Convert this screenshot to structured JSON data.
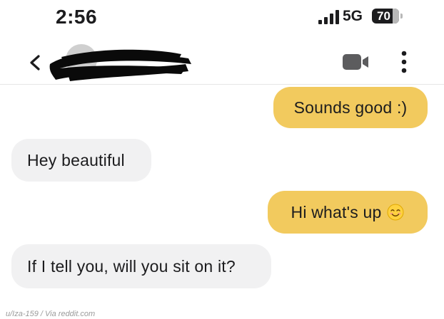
{
  "status_bar": {
    "time": "2:56",
    "network": "5G",
    "battery": "70"
  },
  "header": {
    "back_icon": "chevron-left-icon",
    "video_icon": "video-camera-icon",
    "more_icon": "vertical-dots-icon"
  },
  "messages": [
    {
      "direction": "sent",
      "text": "Sounds good :)"
    },
    {
      "direction": "received",
      "text": "Hey beautiful"
    },
    {
      "direction": "sent",
      "text": "Hi what's up",
      "emoji": "smiling-face-icon"
    },
    {
      "direction": "received",
      "text": "If I tell you, will you sit on it?"
    }
  ],
  "credit": "u/Iza-159 / Via reddit.com",
  "colors": {
    "sent_bubble": "#f2ca5e",
    "received_bubble": "#f1f1f2",
    "text": "#1c1c1e"
  }
}
